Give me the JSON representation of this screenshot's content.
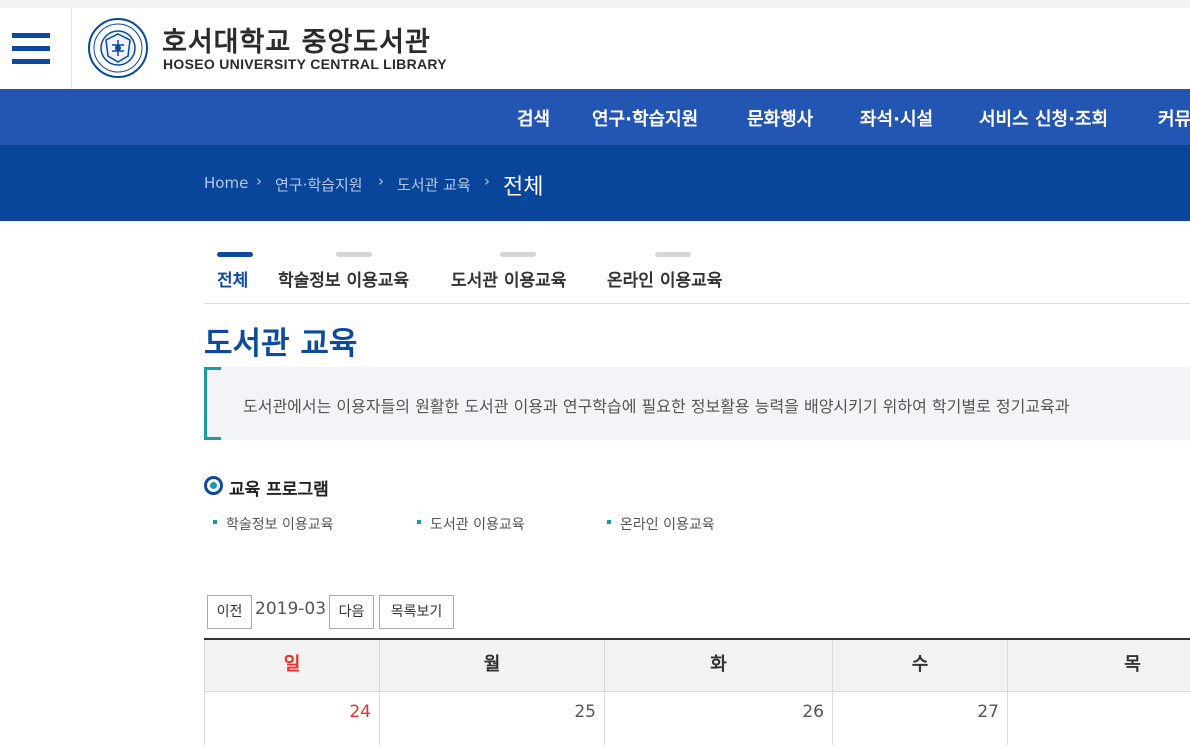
{
  "header": {
    "title_kr": "호서대학교 중앙도서관",
    "title_en": "HOSEO UNIVERSITY CENTRAL LIBRARY"
  },
  "nav": {
    "items": [
      "검색",
      "연구·학습지원",
      "문화행사",
      "좌석·시설",
      "서비스 신청·조회",
      "커뮤"
    ]
  },
  "breadcrumb": {
    "home": "Home",
    "level1": "연구·학습지원",
    "level2": "도서관 교육",
    "current": "전체"
  },
  "tabs": [
    "전체",
    "학술정보 이용교육",
    "도서관 이용교육",
    "온라인 이용교육"
  ],
  "page": {
    "title": "도서관 교육",
    "notice": "도서관에서는 이용자들의 원활한 도서관 이용과 연구학습에 필요한 정보활용 능력을 배양시키기 위하여 학기별로 정기교육과"
  },
  "programs": {
    "title": "교육 프로그램",
    "links": [
      "학술정보 이용교육",
      "도서관 이용교육",
      "온라인 이용교육"
    ]
  },
  "calendar": {
    "prev_label": "이전",
    "month": "2019-03",
    "next_label": "다음",
    "list_label": "목록보기",
    "weekdays": [
      "일",
      "월",
      "화",
      "수",
      "목"
    ],
    "dates": [
      "24",
      "25",
      "26",
      "27",
      ""
    ]
  },
  "colors": {
    "primary": "#0b4a9c",
    "nav": "#2356b3",
    "accent": "#199aa6",
    "sunday": "#e8302c"
  }
}
